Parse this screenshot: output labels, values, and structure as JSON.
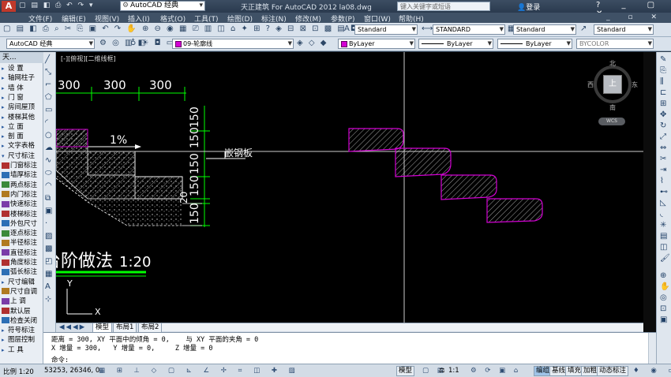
{
  "titlebar": {
    "logo": "A",
    "workspace": "AutoCAD 经典",
    "title": "天正建筑 For AutoCAD 2012    la08.dwg",
    "search_placeholder": "键入关键字或短语",
    "login": "登录"
  },
  "menu": [
    "文件(F)",
    "编辑(E)",
    "视图(V)",
    "插入(I)",
    "格式(O)",
    "工具(T)",
    "绘图(D)",
    "标注(N)",
    "修改(M)",
    "参数(P)",
    "窗口(W)",
    "帮助(H)"
  ],
  "toolbar1": {
    "text_style": "Standard",
    "dim_style": "STANDARD",
    "table_style": "Standard",
    "mleader_style": "Standard"
  },
  "toolbar2": {
    "workspace": "AutoCAD 经典",
    "layer": "09-轮廓线",
    "color": "ByLayer",
    "linetype": "ByLayer",
    "lineweight": "ByLayer",
    "plotstyle": "BYCOLOR"
  },
  "palette": {
    "title": "天...",
    "items": [
      {
        "label": "设    置",
        "expand": "▸"
      },
      {
        "label": "轴网柱子",
        "expand": "▸"
      },
      {
        "label": "墙    体",
        "expand": "▸"
      },
      {
        "label": "门    窗",
        "expand": "▸"
      },
      {
        "label": "房间屋顶",
        "expand": "▸"
      },
      {
        "label": "楼梯其他",
        "expand": "▸"
      },
      {
        "label": "立    面",
        "expand": "▸"
      },
      {
        "label": "剖    面",
        "expand": "▸"
      },
      {
        "label": "文字表格",
        "expand": "▸"
      },
      {
        "label": "尺寸标注",
        "expand": "▾"
      },
      {
        "label": "门窗标注",
        "expand": ""
      },
      {
        "label": "墙厚标注",
        "expand": ""
      },
      {
        "label": "两点标注",
        "expand": ""
      },
      {
        "label": "内门标注",
        "expand": ""
      },
      {
        "label": "快速标注",
        "expand": ""
      },
      {
        "label": "楼梯标注",
        "expand": ""
      },
      {
        "label": "外包尺寸",
        "expand": ""
      },
      {
        "label": "逐点标注",
        "expand": ""
      },
      {
        "label": "半径标注",
        "expand": ""
      },
      {
        "label": "直径标注",
        "expand": ""
      },
      {
        "label": "角度标注",
        "expand": ""
      },
      {
        "label": "弧长标注",
        "expand": ""
      },
      {
        "label": "尺寸编辑",
        "expand": "▸"
      },
      {
        "label": "尺寸自调",
        "expand": ""
      },
      {
        "label": "上    调",
        "expand": ""
      },
      {
        "label": "默认层",
        "expand": ""
      },
      {
        "label": "检查关闭",
        "expand": ""
      },
      {
        "label": "符号标注",
        "expand": "▸"
      },
      {
        "label": "图层控制",
        "expand": "▸"
      },
      {
        "label": "工    具",
        "expand": "▸"
      }
    ]
  },
  "drawing": {
    "dim_top": [
      "300",
      "300",
      "300"
    ],
    "dim_right": [
      "150",
      "150",
      "150",
      "150",
      "20",
      "150"
    ],
    "slope": "1%",
    "annotation": "嵌钢板",
    "heading": "台阶做法",
    "scale": "1:20",
    "tab_label": "[-][俯视][二维线框]",
    "ucs_x": "X",
    "ucs_y": "Y"
  },
  "viewcube": {
    "north": "北",
    "south": "南",
    "west": "西",
    "east": "东",
    "face": "上",
    "wcs": "WCS"
  },
  "layout_tabs": {
    "nav": "◀◀◀▶",
    "model": "模型",
    "layout1": "布局1",
    "layout2": "布局2"
  },
  "command": {
    "line1": "距离 = 300, XY 平面中的倾角 = 0,    与 XY 平面的夹角 = 0",
    "line2": "X 增量 = 300,   Y 增量 = 0,     Z 增量 = 0",
    "prompt": "命令:"
  },
  "status": {
    "scale": "比例 1:20",
    "coords": "53253, 26346, 0",
    "model": "模型",
    "anno_scale": "1:1",
    "buttons": [
      "编组",
      "基线",
      "填充",
      "加粗",
      "动态标注"
    ]
  },
  "colors": {
    "canvas": "#000000",
    "magenta": "#d400d4",
    "green": "#00ff00",
    "yellow": "#ffff00",
    "white": "#ffffff"
  }
}
